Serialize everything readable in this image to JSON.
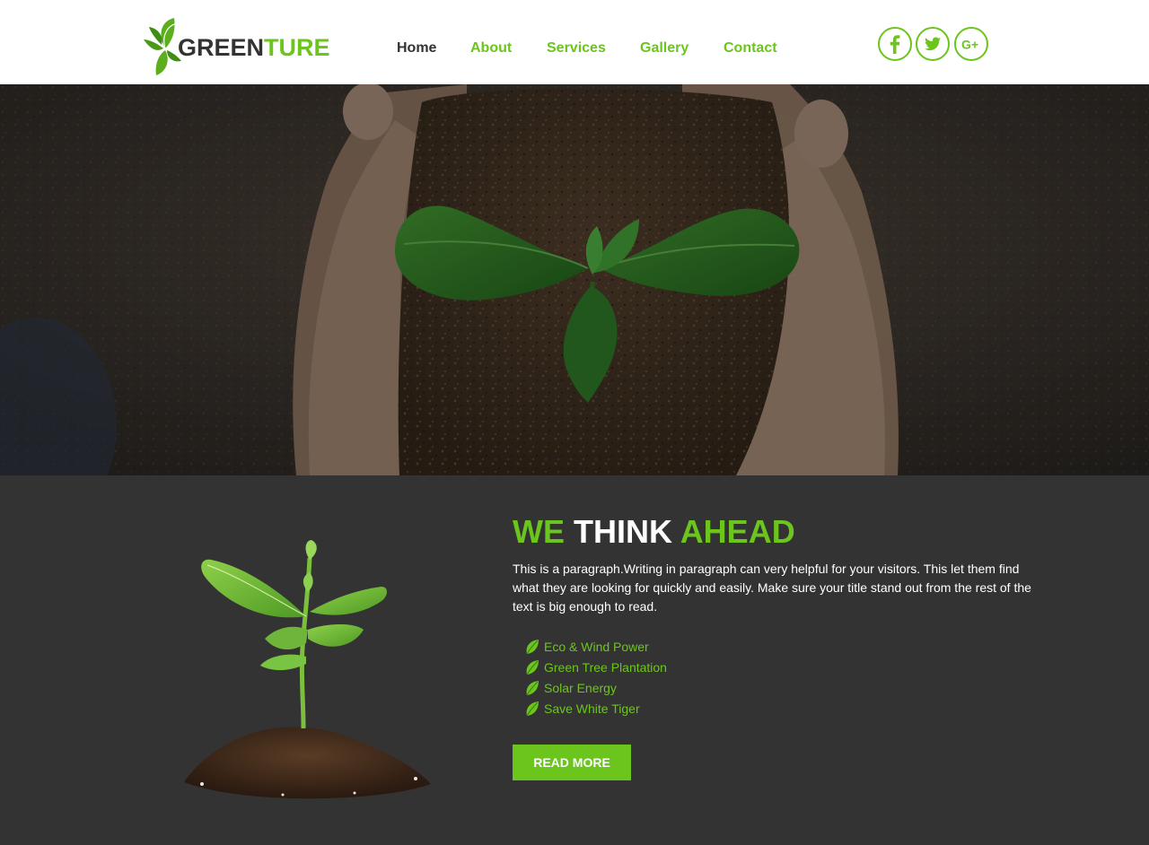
{
  "brand": {
    "name_dark": "GREEN",
    "name_green": "TURE"
  },
  "nav": {
    "items": [
      {
        "label": "Home",
        "active": true
      },
      {
        "label": "About"
      },
      {
        "label": "Services"
      },
      {
        "label": "Gallery"
      },
      {
        "label": "Contact"
      }
    ]
  },
  "social": [
    {
      "icon": "facebook-icon",
      "glyph": "f"
    },
    {
      "icon": "twitter-icon"
    },
    {
      "icon": "google-plus-icon",
      "glyph": "G+"
    }
  ],
  "about": {
    "headline": {
      "part1": "WE",
      "part2": "THINK",
      "part3": "AHEAD"
    },
    "paragraph": "This is a paragraph.Writing in paragraph can very helpful for your visitors. This let them find what they are looking for quickly and easily. Make sure your title stand out from the rest of the text is big enough to read.",
    "features": [
      "Eco & Wind Power",
      "Green Tree Plantation",
      "Solar Energy",
      "Save White Tiger"
    ],
    "cta": "READ MORE"
  },
  "colors": {
    "accent": "#6cc51d",
    "dark": "#333333",
    "white": "#ffffff"
  }
}
